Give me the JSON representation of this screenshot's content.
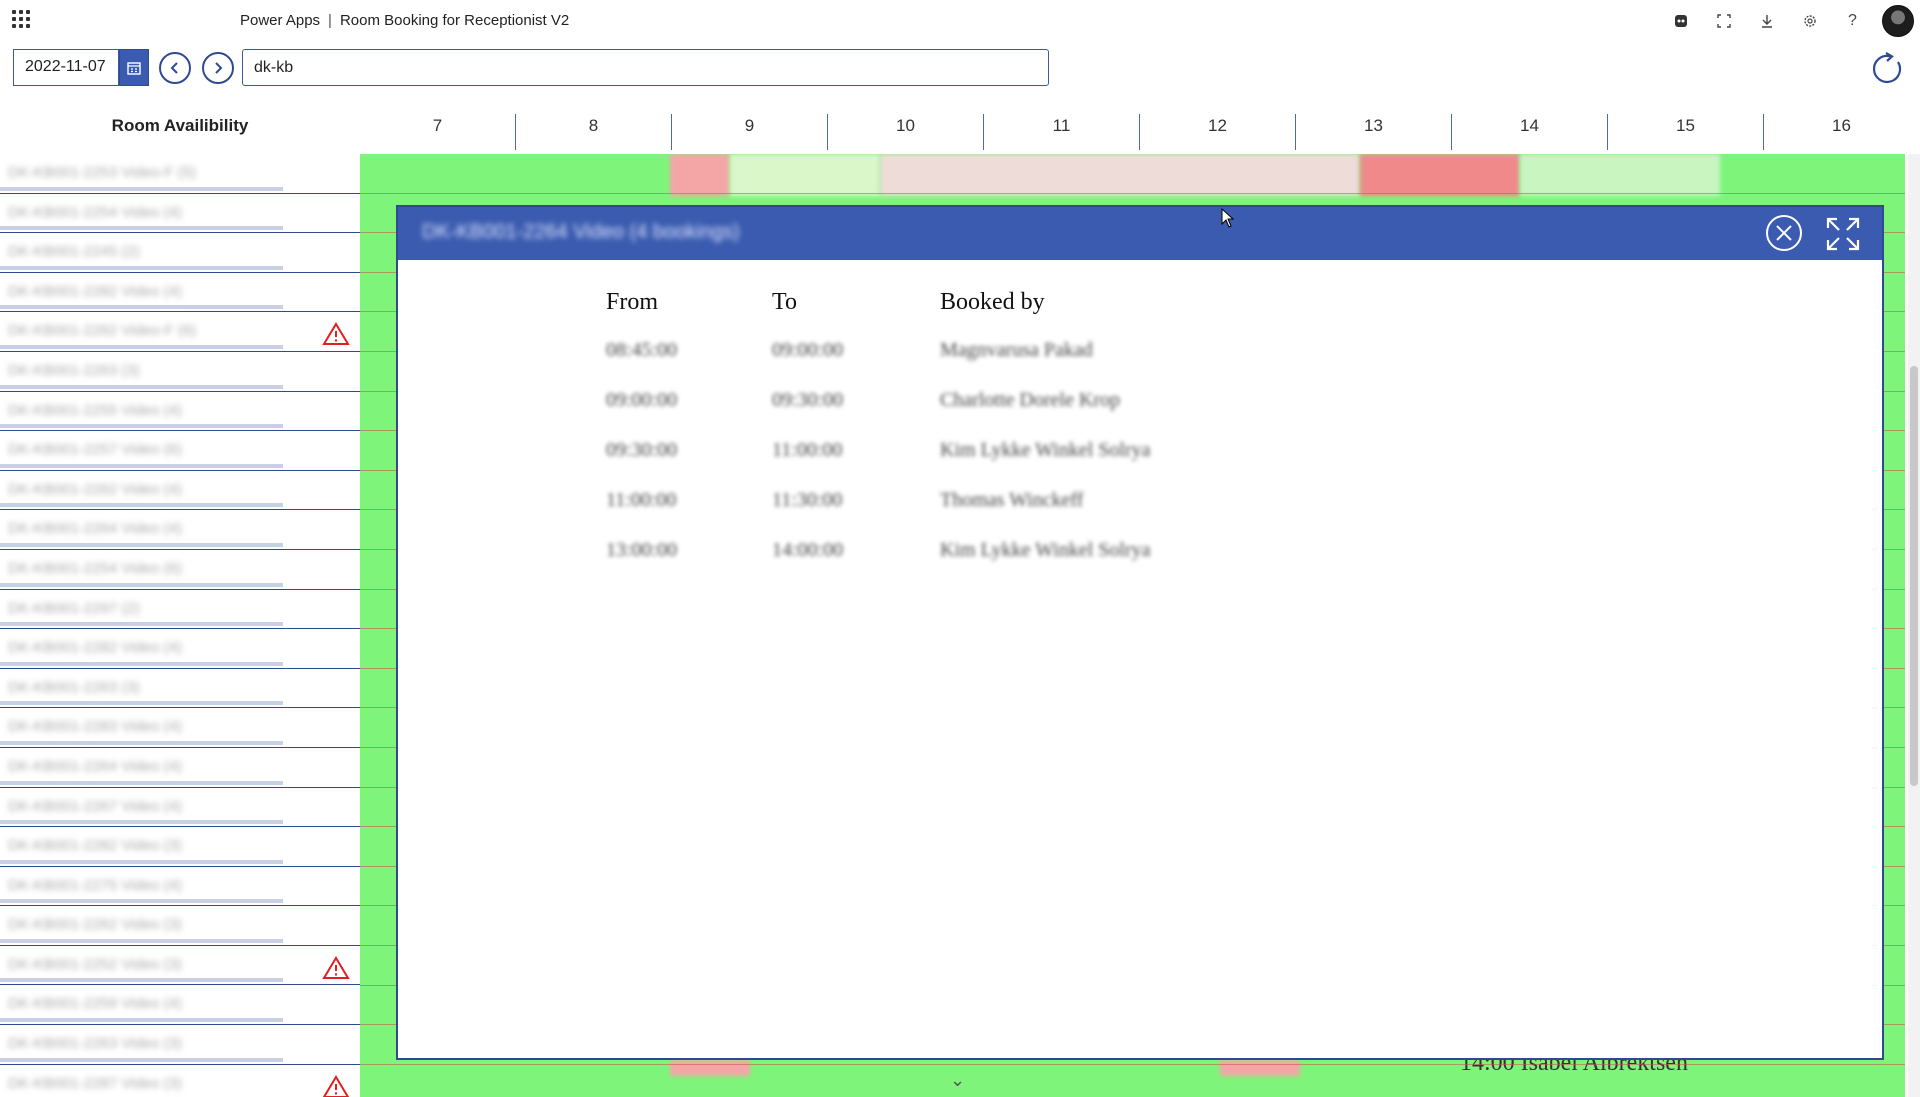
{
  "app": {
    "product": "Power Apps",
    "title": "Room Booking for Receptionist V2"
  },
  "toolbar": {
    "date": "2022-11-07",
    "search_value": "dk-kb"
  },
  "schedule": {
    "room_header": "Room Availibility",
    "hours": [
      "7",
      "8",
      "9",
      "10",
      "11",
      "12",
      "13",
      "14",
      "15",
      "16"
    ],
    "visible_booking_text": "14:00 Isabel Albrektsen"
  },
  "modal": {
    "title": "DK-KB001-2264 Video (4 bookings)",
    "columns": {
      "from": "From",
      "to": "To",
      "booked_by": "Booked by"
    },
    "rows": [
      {
        "from": "08:45:00",
        "to": "09:00:00",
        "booked_by": "Magnvarusa Pakad"
      },
      {
        "from": "09:00:00",
        "to": "09:30:00",
        "booked_by": "Charlotte Dorele Krop"
      },
      {
        "from": "09:30:00",
        "to": "11:00:00",
        "booked_by": "Kim Lykke Winkel Solrya"
      },
      {
        "from": "11:00:00",
        "to": "11:30:00",
        "booked_by": "Thomas Winckeff"
      },
      {
        "from": "13:00:00",
        "to": "14:00:00",
        "booked_by": "Kim Lykke Winkel Solrya"
      }
    ]
  },
  "rooms": [
    "DK-KB001-2253 Video-F (5)",
    "DK-KB001-2254 Video (4)",
    "DK-KB001-2245 (2)",
    "DK-KB001-2282 Video (4)",
    "DK-KB001-2262 Video-F (6)",
    "DK-KB001-2263 (3)",
    "DK-KB001-2255 Video (4)",
    "DK-KB001-2257 Video (6)",
    "DK-KB001-2262 Video (4)",
    "DK-KB001-2264 Video (4)",
    "DK-KB001-2254 Video (6)",
    "DK-KB001-2297 (2)",
    "DK-KB001-2282 Video (4)",
    "DK-KB001-2263 (3)",
    "DK-KB001-2283 Video (4)",
    "DK-KB001-2264 Video (4)",
    "DK-KB001-2267 Video (4)",
    "DK-KB001-2282 Video (3)",
    "DK-KB001-2275 Video (4)",
    "DK-KB001-2262 Video (3)",
    "DK-KB001-2252 Video (3)",
    "DK-KB001-2259 Video (4)",
    "DK-KB001-2263 Video (3)",
    "DK-KB001-2287 Video (3)"
  ],
  "warnings_at_rows": [
    4,
    20,
    23
  ],
  "colors": {
    "accent": "#3a5bb0",
    "available": "#7ef57a",
    "booked": "#f4a6a6",
    "warning": "#e02020"
  }
}
